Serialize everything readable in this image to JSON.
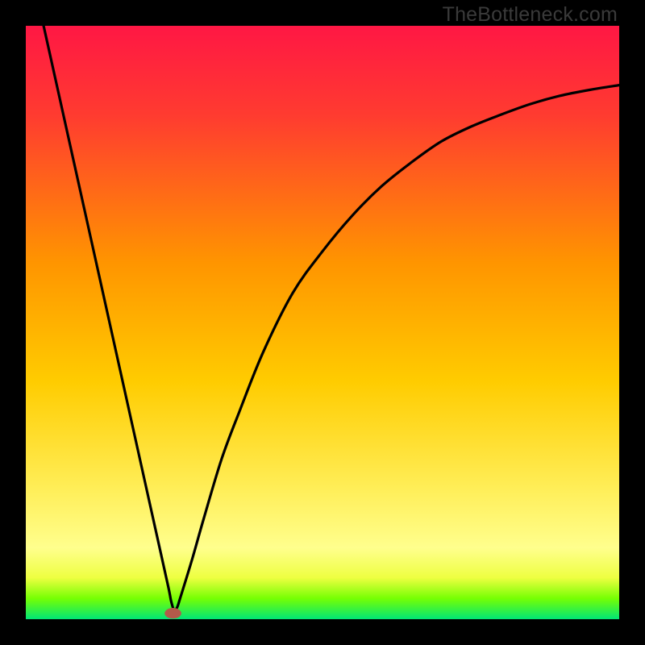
{
  "watermark": {
    "text": "TheBottleneck.com"
  },
  "chart_data": {
    "type": "line",
    "title": "",
    "xlabel": "",
    "ylabel": "",
    "xlim": [
      0,
      100
    ],
    "ylim": [
      0,
      100
    ],
    "grid": false,
    "legend": false,
    "background_gradient": {
      "stops": [
        {
          "offset": 0.0,
          "color": "#ff1744"
        },
        {
          "offset": 0.15,
          "color": "#ff3b30"
        },
        {
          "offset": 0.4,
          "color": "#ff9500"
        },
        {
          "offset": 0.6,
          "color": "#ffcc00"
        },
        {
          "offset": 0.78,
          "color": "#ffee58"
        },
        {
          "offset": 0.88,
          "color": "#ffff8d"
        },
        {
          "offset": 0.93,
          "color": "#eeff41"
        },
        {
          "offset": 0.965,
          "color": "#76ff03"
        },
        {
          "offset": 1.0,
          "color": "#00e676"
        }
      ]
    },
    "series": [
      {
        "name": "bottleneck-curve",
        "x": [
          3,
          4,
          6,
          8,
          10,
          12,
          14,
          16,
          18,
          20,
          22,
          24,
          24.5,
          25,
          25.5,
          26,
          28,
          30,
          33,
          36,
          40,
          45,
          50,
          55,
          60,
          65,
          70,
          75,
          80,
          85,
          90,
          95,
          100
        ],
        "y": [
          100,
          95.5,
          86.5,
          77.5,
          68.5,
          59.5,
          50.5,
          41.5,
          32.5,
          23.5,
          14.5,
          5.5,
          3,
          1.5,
          2,
          3.5,
          10,
          17,
          27,
          35,
          45,
          55,
          62,
          68,
          73,
          77,
          80.5,
          83,
          85,
          86.8,
          88.2,
          89.2,
          90
        ]
      }
    ],
    "marker": {
      "name": "minimum-marker",
      "x": 24.8,
      "y": 1.0,
      "rx": 1.4,
      "ry": 0.9,
      "color": "#b35a4a"
    }
  }
}
